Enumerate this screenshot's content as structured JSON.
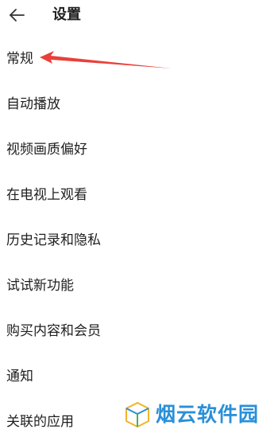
{
  "header": {
    "back_icon": "arrow-left-icon",
    "title": "设置"
  },
  "menu": {
    "items": [
      {
        "label": "常规"
      },
      {
        "label": "自动播放"
      },
      {
        "label": "视频画质偏好"
      },
      {
        "label": "在电视上观看"
      },
      {
        "label": "历史记录和隐私"
      },
      {
        "label": "试试新功能"
      },
      {
        "label": "购买内容和会员"
      },
      {
        "label": "通知"
      },
      {
        "label": "关联的应用"
      }
    ]
  },
  "annotation": {
    "icon": "red-pointer-arrow",
    "color": "#e8403a"
  },
  "watermark": {
    "icon": "cube-logo-icon",
    "text": "烟云软件园",
    "color": "#2a8fd8"
  }
}
